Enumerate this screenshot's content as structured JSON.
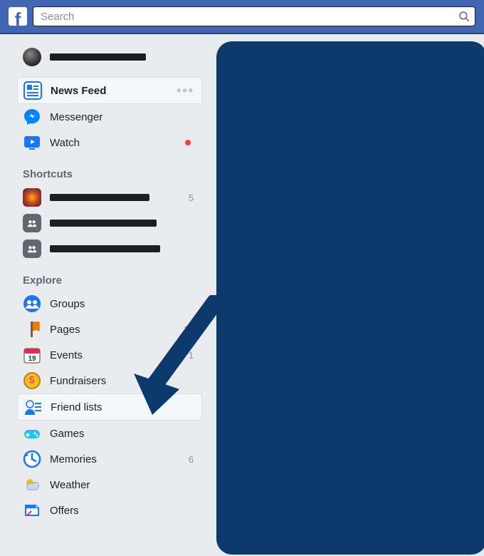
{
  "search": {
    "placeholder": "Search"
  },
  "profile": {
    "name": ""
  },
  "main_nav": {
    "news_feed": {
      "label": "News Feed"
    },
    "messenger": {
      "label": "Messenger"
    },
    "watch": {
      "label": "Watch"
    }
  },
  "sections": {
    "shortcuts": {
      "title": "Shortcuts"
    },
    "explore": {
      "title": "Explore"
    }
  },
  "shortcuts": [
    {
      "count": "5"
    },
    {
      "count": ""
    },
    {
      "count": ""
    }
  ],
  "explore": {
    "groups": {
      "label": "Groups"
    },
    "pages": {
      "label": "Pages",
      "count": "14"
    },
    "events": {
      "label": "Events",
      "count": "1"
    },
    "fundraisers": {
      "label": "Fundraisers"
    },
    "friend_lists": {
      "label": "Friend lists"
    },
    "games": {
      "label": "Games"
    },
    "memories": {
      "label": "Memories",
      "count": "6"
    },
    "weather": {
      "label": "Weather"
    },
    "offers": {
      "label": "Offers"
    }
  },
  "colors": {
    "brand": "#4267b2",
    "panel": "#0d3a6c"
  }
}
